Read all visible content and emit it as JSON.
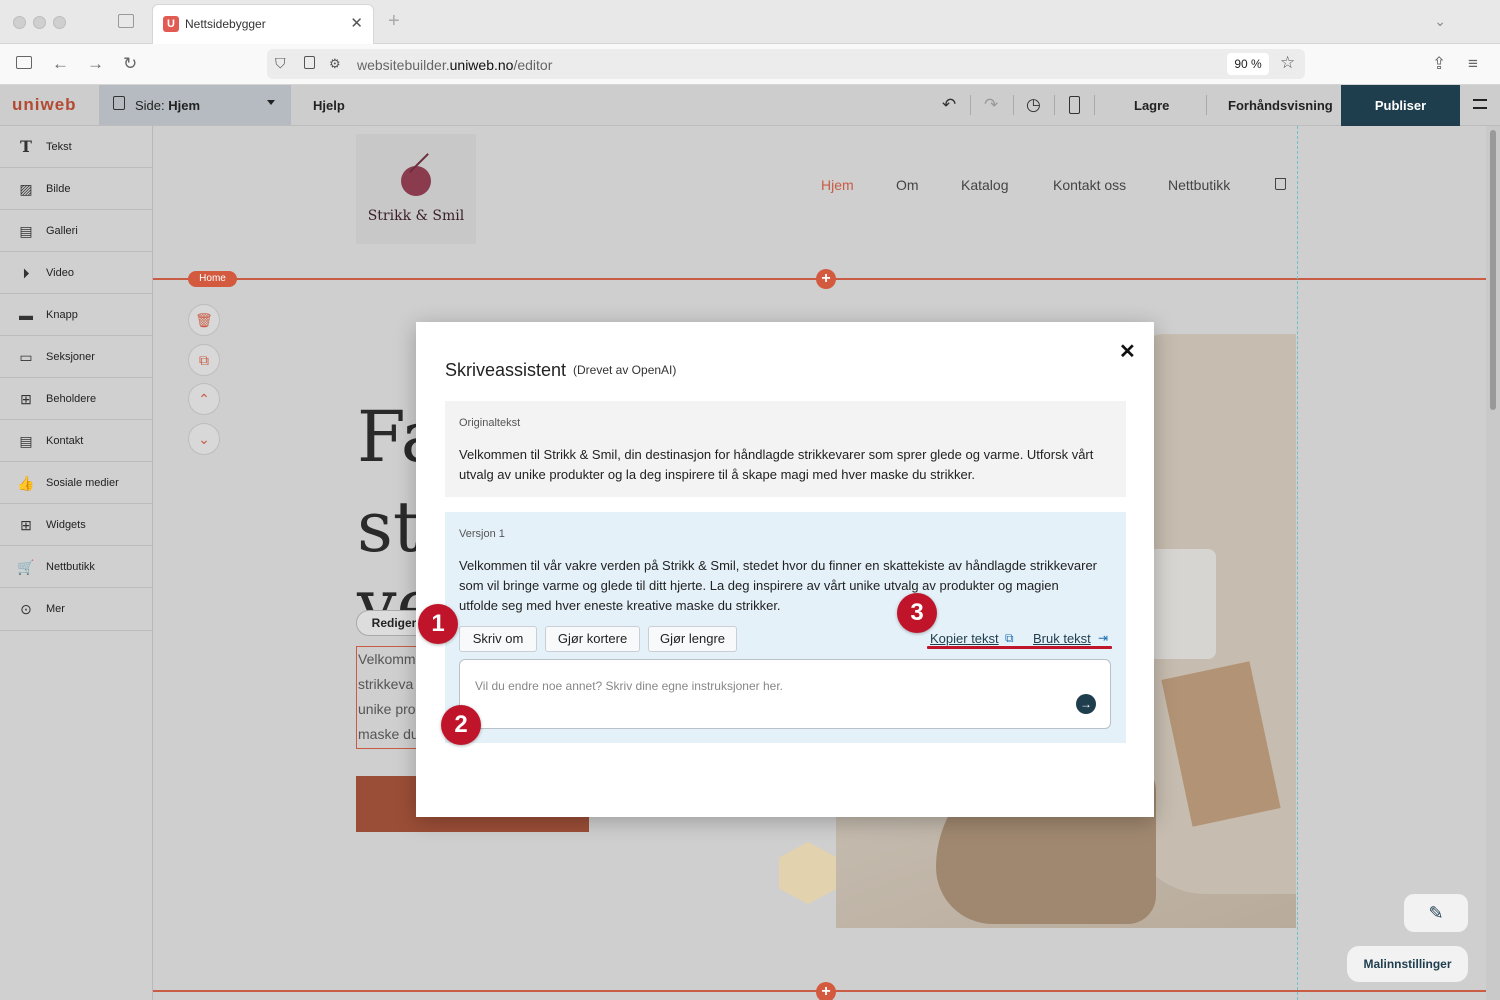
{
  "browser": {
    "tab_title": "Nettsidebygger",
    "tab_favicon": "U",
    "url_prefix": "websitebuilder.",
    "url_domain": "uniweb.no",
    "url_path": "/editor",
    "zoom": "90 %"
  },
  "app": {
    "logo": "uniweb",
    "page_label_prefix": "Side: ",
    "page_name": "Hjem",
    "help": "Hjelp",
    "save": "Lagre",
    "preview": "Forhåndsvisning",
    "publish": "Publiser"
  },
  "sidebar": {
    "items": [
      {
        "label": "Tekst",
        "icon": "text-icon"
      },
      {
        "label": "Bilde",
        "icon": "image-icon"
      },
      {
        "label": "Galleri",
        "icon": "gallery-icon"
      },
      {
        "label": "Video",
        "icon": "video-icon"
      },
      {
        "label": "Knapp",
        "icon": "button-icon"
      },
      {
        "label": "Seksjoner",
        "icon": "sections-icon"
      },
      {
        "label": "Beholdere",
        "icon": "containers-icon"
      },
      {
        "label": "Kontakt",
        "icon": "contact-icon"
      },
      {
        "label": "Sosiale medier",
        "icon": "thumbs-up-icon"
      },
      {
        "label": "Widgets",
        "icon": "widgets-icon"
      },
      {
        "label": "Nettbutikk",
        "icon": "cart-icon"
      },
      {
        "label": "Mer",
        "icon": "more-icon"
      }
    ]
  },
  "site": {
    "name": "Strikk & Smil",
    "nav": [
      "Hjem",
      "Om",
      "Katalog",
      "Kontakt oss",
      "Nettbutikk"
    ],
    "home_badge": "Home",
    "hero_lines": [
      "Fa",
      "st",
      "ve"
    ],
    "edit_button": "Rediger",
    "body_lines": [
      "Velkomm",
      "strikkeva",
      "unike pro",
      "maske du"
    ],
    "accent": "#c95c44"
  },
  "modal": {
    "title": "Skriveassistent",
    "subtitle": "(Drevet av OpenAI)",
    "original_label": "Originaltekst",
    "original_lines": [
      "Velkommen til Strikk & Smil, din destinasjon for håndlagde strikkevarer som sprer glede og varme. Utforsk vårt",
      "utvalg av unike produkter og la deg inspirere til å skape magi med hver maske du strikker."
    ],
    "version_label": "Versjon 1",
    "version_lines": [
      "Velkommen til vår vakre verden på Strikk & Smil, stedet hvor du finner en skattekiste av håndlagde strikkevarer",
      "som vil bringe varme og glede til ditt hjerte. La deg inspirere av vårt unike utvalg av produkter og magien",
      "utfolde seg med hver eneste kreative maske du strikker."
    ],
    "rewrite": "Skriv om",
    "shorter": "Gjør kortere",
    "longer": "Gjør lengre",
    "copy_text": "Kopier tekst",
    "use_text": "Bruk tekst",
    "instructions_placeholder": "Vil du endre noe annet? Skriv dine egne instruksjoner her."
  },
  "callouts": [
    "1",
    "2",
    "3"
  ],
  "template_settings": "Malinnstillinger"
}
